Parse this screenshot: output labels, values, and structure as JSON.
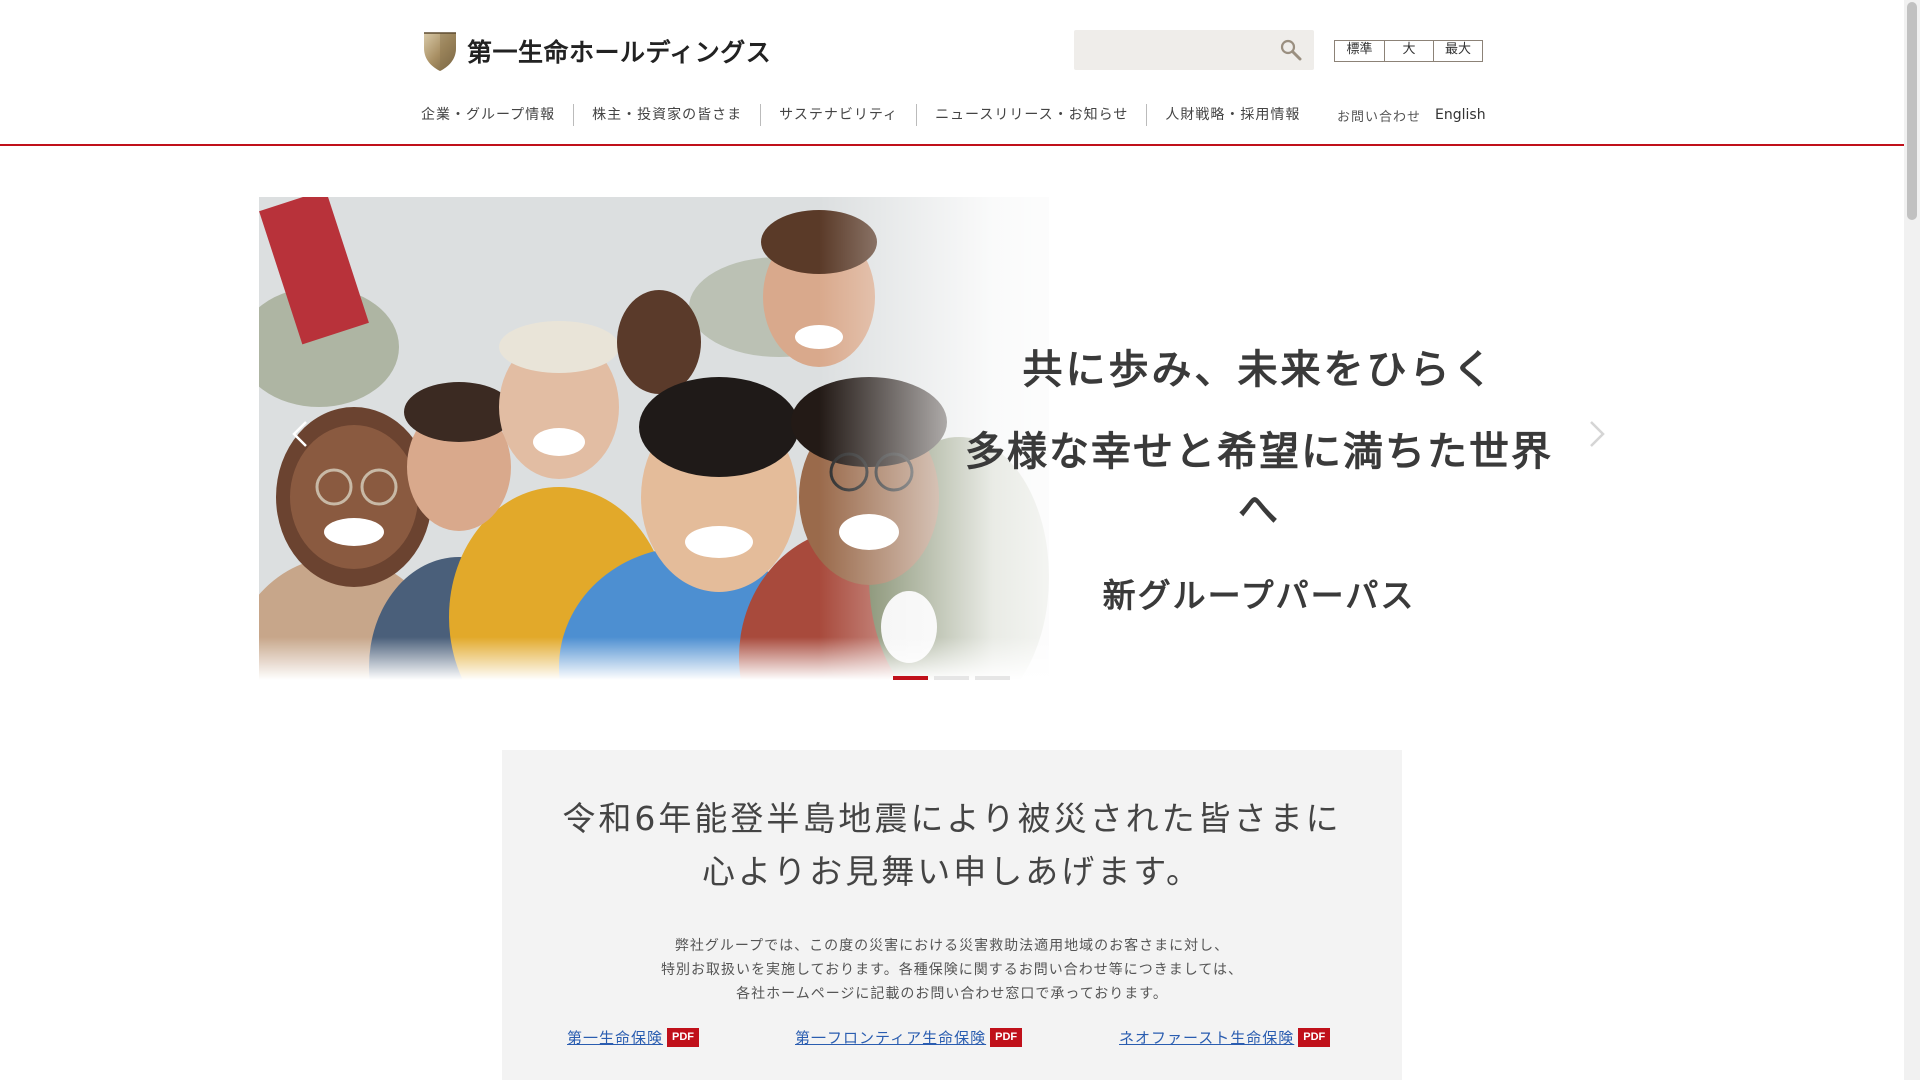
{
  "header": {
    "logo_text": "第一生命ホールディングス",
    "search": {
      "placeholder": "",
      "value": ""
    },
    "font_size": {
      "standard": "標準",
      "large": "大",
      "largest": "最大"
    },
    "nav": [
      {
        "label": "企業・グループ情報"
      },
      {
        "label": "株主・投資家の皆さま"
      },
      {
        "label": "サステナビリティ"
      },
      {
        "label": "ニュースリリース・お知らせ"
      },
      {
        "label": "人財戦略・採用情報"
      }
    ],
    "contact_label": "お問い合わせ",
    "english_label": "English",
    "accent_color": "#c0101a"
  },
  "hero": {
    "line1": "共に歩み、未来をひらく",
    "line2": "多様な幸せと希望に満ちた世界へ",
    "line3": "新グループパーパス",
    "slides_total": 3,
    "slide_active": 1
  },
  "notice": {
    "title_line1": "令和6年能登半島地震により被災された皆さまに",
    "title_line2": "心よりお見舞い申しあげます。",
    "body_line1": "弊社グループでは、この度の災害における災害救助法適用地域のお客さまに対し、",
    "body_line2": "特別お取扱いを実施しております。各種保険に関するお問い合わせ等につきましては、",
    "body_line3": "各社ホームページに記載のお問い合わせ窓口で承っております。",
    "links": [
      {
        "label": "第一生命保険",
        "badge": "PDF"
      },
      {
        "label": "第一フロンティア生命保険",
        "badge": "PDF"
      },
      {
        "label": "ネオファースト生命保険",
        "badge": "PDF"
      }
    ]
  }
}
